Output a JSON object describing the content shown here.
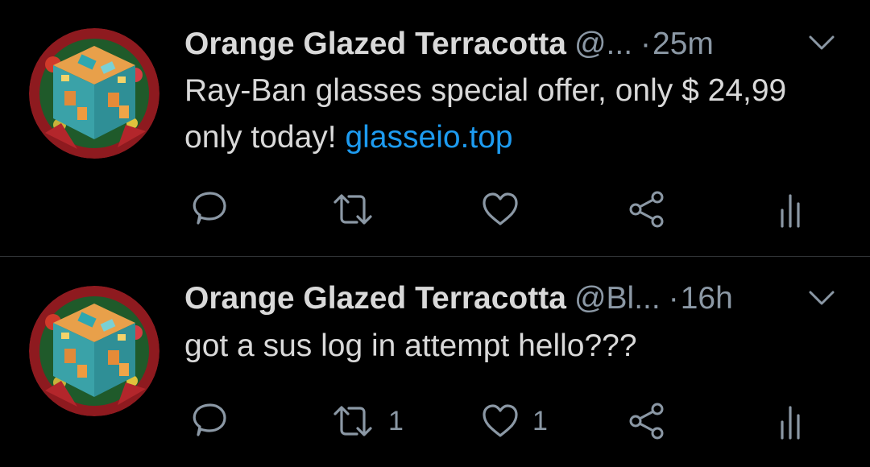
{
  "tweets": [
    {
      "display_name": "Orange Glazed Terracotta",
      "handle": "@...",
      "separator": "·",
      "timestamp": "25m",
      "text_before_link": "Ray-Ban glasses special offer, only $ 24,99 only today! ",
      "link_text": "glasseio.top",
      "reply_count": "",
      "retweet_count": "",
      "like_count": ""
    },
    {
      "display_name": "Orange Glazed Terracotta",
      "handle": "@Bl...",
      "separator": "·",
      "timestamp": "16h",
      "text_before_link": "got a sus log in attempt hello???",
      "link_text": "",
      "reply_count": "",
      "retweet_count": "1",
      "like_count": "1"
    }
  ],
  "icons": {
    "avatar": "minecraft-terracotta-block-avatar",
    "caret": "chevron-down-icon",
    "reply": "reply-bubble-icon",
    "retweet": "retweet-arrows-icon",
    "like": "heart-icon",
    "share": "share-nodes-icon",
    "analytics": "analytics-bars-icon"
  },
  "colors": {
    "background": "#000000",
    "text": "#d9d9d9",
    "muted": "#8b98a5",
    "link": "#1d9bf0",
    "divider": "#2f3336"
  }
}
